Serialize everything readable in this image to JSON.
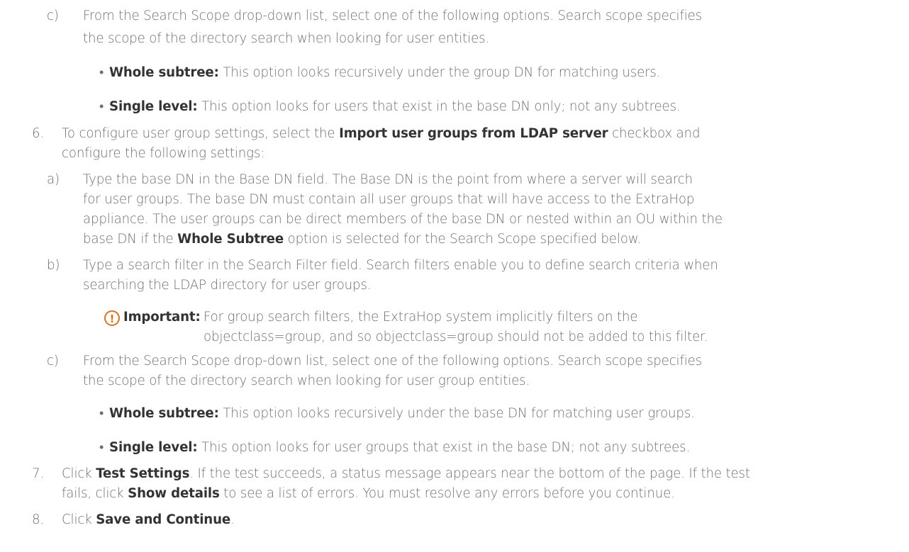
{
  "steps": [
    {
      "marker": "c)",
      "lines": [
        "From the Search Scope drop-down list, select one of the following options. Search scope specifies",
        "the scope of the directory search when looking for user entities."
      ]
    },
    {
      "bullet": "•",
      "label": "Whole subtree:",
      "text": " This option looks recursively under the group DN for matching users."
    },
    {
      "bullet": "•",
      "label": "Single level:",
      "text": " This option looks for users that exist in the base DN only; not any subtrees."
    },
    {
      "marker": "6.",
      "line1_pre": "To configure user group settings, select the ",
      "line1_bold": "Import user groups from LDAP server",
      "line1_post": " checkbox and",
      "line2": "configure the following settings:"
    },
    {
      "marker": "a)",
      "lines": [
        "Type the base DN in the Base DN field. The Base DN is the point from where a server will search",
        "for user groups. The base DN must contain all user groups that will have access to the ExtraHop",
        "appliance. The user groups can be direct members of the base DN or nested within an OU within the"
      ],
      "last_pre": "base DN if the ",
      "last_bold": "Whole Subtree",
      "last_post": " option is selected for the Search Scope specified below."
    },
    {
      "marker": "b)",
      "lines": [
        "Type a search filter in the Search Filter field. Search filters enable you to define search criteria when",
        "searching the LDAP directory for user groups."
      ]
    },
    {
      "note_label": "Important:",
      "note_lines": [
        "For group search filters, the ExtraHop system implicitly filters on the",
        "objectclass=group, and so objectclass=group should not be added to this filter."
      ]
    },
    {
      "marker": "c)",
      "lines": [
        "From the Search Scope drop-down list, select one of the following options. Search scope specifies",
        "the scope of the directory search when looking for user group entities."
      ]
    },
    {
      "bullet": "•",
      "label": "Whole subtree:",
      "text": " This option looks recursively under the base DN for matching user groups."
    },
    {
      "bullet": "•",
      "label": "Single level:",
      "text": " This option looks for user groups that exist in the base DN; not any subtrees."
    },
    {
      "marker": "7.",
      "pre": "Click ",
      "bold1": "Test Settings",
      "mid": ". If the test succeeds, a status message appears near the bottom of the page. If the test",
      "line2_pre": "fails, click ",
      "bold2": "Show details",
      "line2_post": " to see a list of errors. You must resolve any errors before you continue."
    },
    {
      "marker": "8.",
      "pre": "Click ",
      "bold": "Save and Continue",
      "post": "."
    }
  ]
}
